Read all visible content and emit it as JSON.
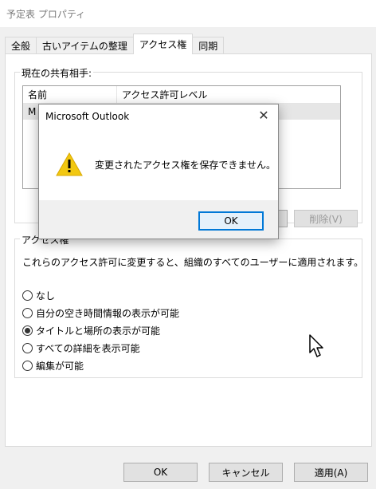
{
  "window": {
    "title": "予定表 プロパティ"
  },
  "tabs": [
    {
      "label": "全般",
      "active": false
    },
    {
      "label": "古いアイテムの整理",
      "active": false
    },
    {
      "label": "アクセス権",
      "active": true
    },
    {
      "label": "同期",
      "active": false
    }
  ],
  "share_group": {
    "title": "現在の共有相手:",
    "columns": [
      "名前",
      "アクセス許可レベル"
    ],
    "rows": [
      {
        "name": "M"
      }
    ],
    "delete_button": "削除(V)"
  },
  "access_group": {
    "title": "アクセス権",
    "description": "これらのアクセス許可に変更すると、組織のすべてのユーザーに適用されます。",
    "options": [
      {
        "label": "なし",
        "selected": false
      },
      {
        "label": "自分の空き時間情報の表示が可能",
        "selected": false
      },
      {
        "label": "タイトルと場所の表示が可能",
        "selected": true
      },
      {
        "label": "すべての詳細を表示可能",
        "selected": false
      },
      {
        "label": "編集が可能",
        "selected": false
      }
    ]
  },
  "bottom_buttons": {
    "ok": "OK",
    "cancel": "キャンセル",
    "apply": "適用(A)"
  },
  "dialog": {
    "title": "Microsoft Outlook",
    "message": "変更されたアクセス権を保存できません。",
    "ok": "OK",
    "icon": "warning-icon"
  },
  "colors": {
    "accent": "#0078d7",
    "warning": "#f2c811"
  }
}
